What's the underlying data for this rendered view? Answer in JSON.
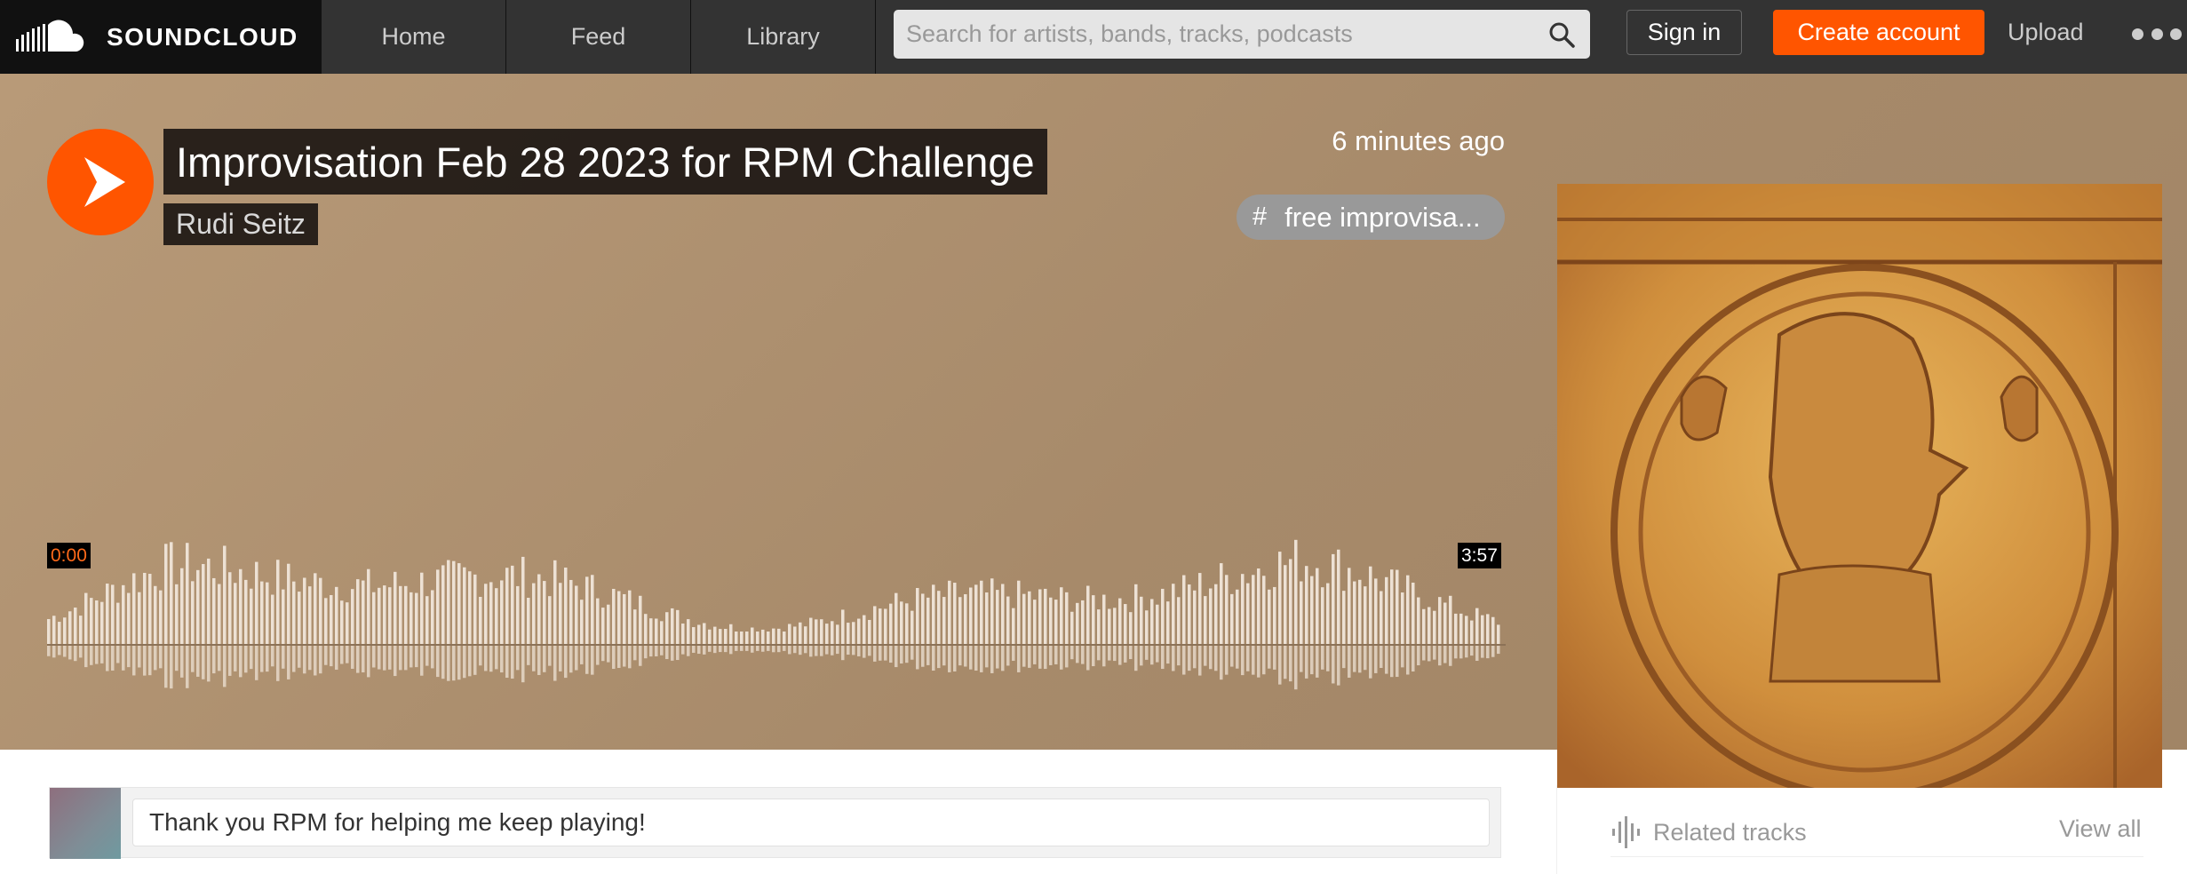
{
  "header": {
    "logo_text": "SOUNDCLOUD",
    "nav": [
      {
        "label": "Home"
      },
      {
        "label": "Feed"
      },
      {
        "label": "Library"
      }
    ],
    "search_placeholder": "Search for artists, bands, tracks, podcasts",
    "sign_in": "Sign in",
    "create_account": "Create account",
    "upload": "Upload",
    "more_icon": "ellipsis-icon"
  },
  "track": {
    "title": "Improvisation Feb 28 2023 for RPM Challenge",
    "artist": "Rudi Seitz",
    "posted": "6 minutes ago",
    "tag_symbol": "#",
    "tag": "free improvisa...",
    "time_start": "0:00",
    "duration": "3:57",
    "progress": 0
  },
  "comment": {
    "value": "Thank you RPM for helping me keep playing!"
  },
  "sidebar": {
    "related_tracks": "Related tracks",
    "view_all": "View all"
  },
  "colors": {
    "brand_orange": "#ff5500",
    "header_bg": "#333333",
    "hero_bg": "#a88b6b",
    "waveform": "#ede1d4"
  }
}
